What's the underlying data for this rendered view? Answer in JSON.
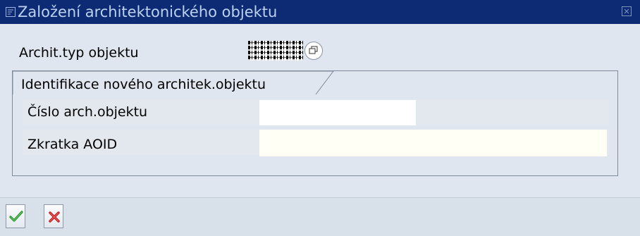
{
  "window": {
    "title": "Založení architektonického objektu",
    "titlebar_color": "#0c2b74",
    "title_color": "#bcd2f0"
  },
  "form": {
    "typ_label": "Archit.typ objektu",
    "typ_value_redacted": true,
    "group_title": "Identifikace nového architek.objektu",
    "cislo_label": "Číslo arch.objektu",
    "cislo_value": "",
    "zkratka_label": "Zkratka AOID",
    "zkratka_value": ""
  },
  "toolbar": {
    "ok_icon": "green-check-icon",
    "cancel_icon": "red-x-icon"
  }
}
